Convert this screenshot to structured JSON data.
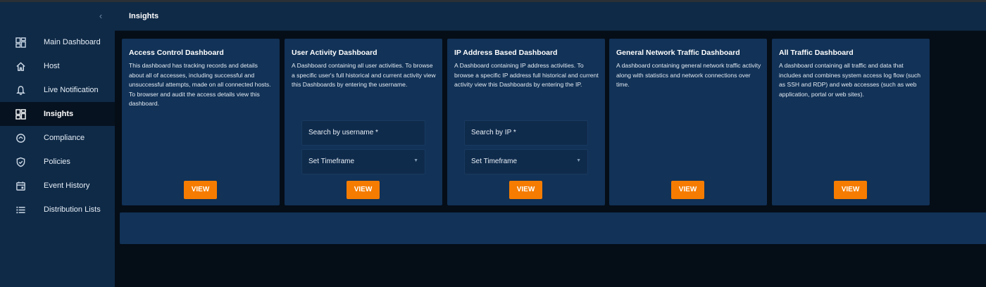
{
  "header": {
    "title": "Insights"
  },
  "sidebar": {
    "collapse_icon": "‹",
    "items": [
      {
        "label": "Main Dashboard",
        "icon": "dashboard-icon",
        "active": false
      },
      {
        "label": "Host",
        "icon": "home-icon",
        "active": false
      },
      {
        "label": "Live Notification",
        "icon": "bell-icon",
        "active": false
      },
      {
        "label": "Insights",
        "icon": "insights-icon",
        "active": true
      },
      {
        "label": "Compliance",
        "icon": "compliance-icon",
        "active": false
      },
      {
        "label": "Policies",
        "icon": "shield-icon",
        "active": false
      },
      {
        "label": "Event History",
        "icon": "calendar-icon",
        "active": false
      },
      {
        "label": "Distribution Lists",
        "icon": "list-icon",
        "active": false
      }
    ]
  },
  "cards": [
    {
      "title": "Access Control Dashboard",
      "description": "This dashboard has tracking records and details about all of accesses, including successful and unsuccessful attempts, made on all connected hosts. To browser and audit the access details view this dashboard.",
      "button": "VIEW"
    },
    {
      "title": "User Activity Dashboard",
      "description": "A Dashboard containing all user activities. To browse a specific user's full historical and current activity view this Dashboards by entering the username.",
      "search_label": "Search by username *",
      "timeframe_label": "Set Timeframe",
      "button": "VIEW"
    },
    {
      "title": "IP Address Based Dashboard",
      "description": "A Dashboard containing IP address activities. To browse a specific IP address full historical and current activity view this Dashboards by entering the IP.",
      "search_label": "Search by IP *",
      "timeframe_label": "Set Timeframe",
      "button": "VIEW"
    },
    {
      "title": "General Network Traffic Dashboard",
      "description": "A dashboard containing general network traffic activity along with statistics and network connections over time.",
      "button": "VIEW"
    },
    {
      "title": "All Traffic Dashboard",
      "description": "A dashboard containing all traffic and data that includes and combines system access log flow (such as SSH and RDP) and web accesses (such as web application, portal or web sites).",
      "button": "VIEW"
    }
  ],
  "colors": {
    "sidebar_bg": "#0f2a47",
    "card_bg": "#123257",
    "accent": "#f57c00",
    "page_bg": "#050d17"
  }
}
